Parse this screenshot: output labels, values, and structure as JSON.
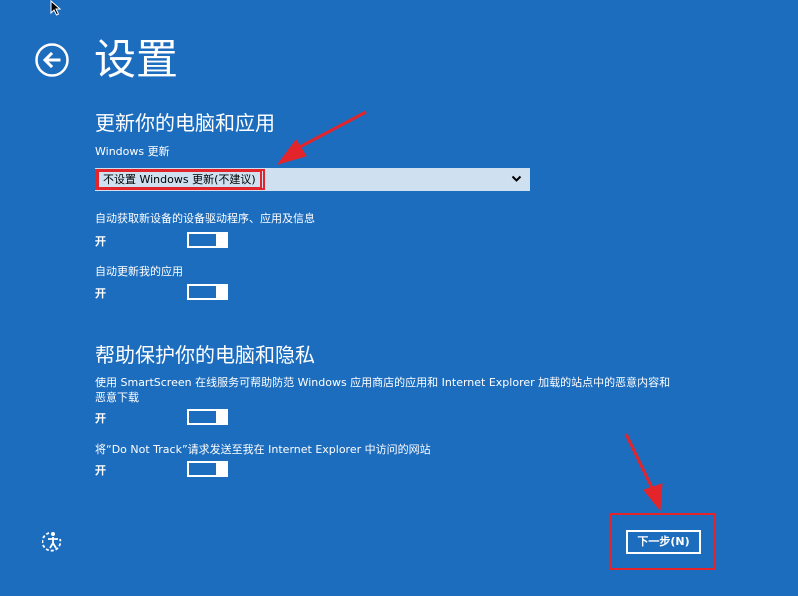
{
  "page": {
    "title": "设置"
  },
  "update_section": {
    "heading": "更新你的电脑和应用",
    "windows_update_label": "Windows 更新",
    "windows_update_value": "不设置 Windows 更新(不建议)",
    "auto_driver_label": "自动获取新设备的设备驱动程序、应用及信息",
    "auto_driver_state": "开",
    "auto_driver_on": true,
    "auto_app_label": "自动更新我的应用",
    "auto_app_state": "开",
    "auto_app_on": true
  },
  "privacy_section": {
    "heading": "帮助保护你的电脑和隐私",
    "smartscreen_label_line1": "使用 SmartScreen 在线服务可帮助防范 Windows 应用商店的应用和 Internet Explorer 加载的站点中的恶意内容和",
    "smartscreen_label_line2": "恶意下载",
    "smartscreen_state": "开",
    "smartscreen_on": true,
    "dnt_label": "将“Do Not Track”请求发送至我在 Internet Explorer 中访问的网站",
    "dnt_state": "开",
    "dnt_on": true
  },
  "footer": {
    "next_label": "下一步(N)"
  },
  "icons": {
    "back": "back-arrow-icon",
    "ease_of_access": "ease-of-access-icon",
    "cursor": "mouse-pointer-icon",
    "chevron": "chevron-down-icon"
  },
  "colors": {
    "background": "#1d6dbf",
    "highlight": "#e3242b",
    "select_bg": "#cfe0f1"
  }
}
